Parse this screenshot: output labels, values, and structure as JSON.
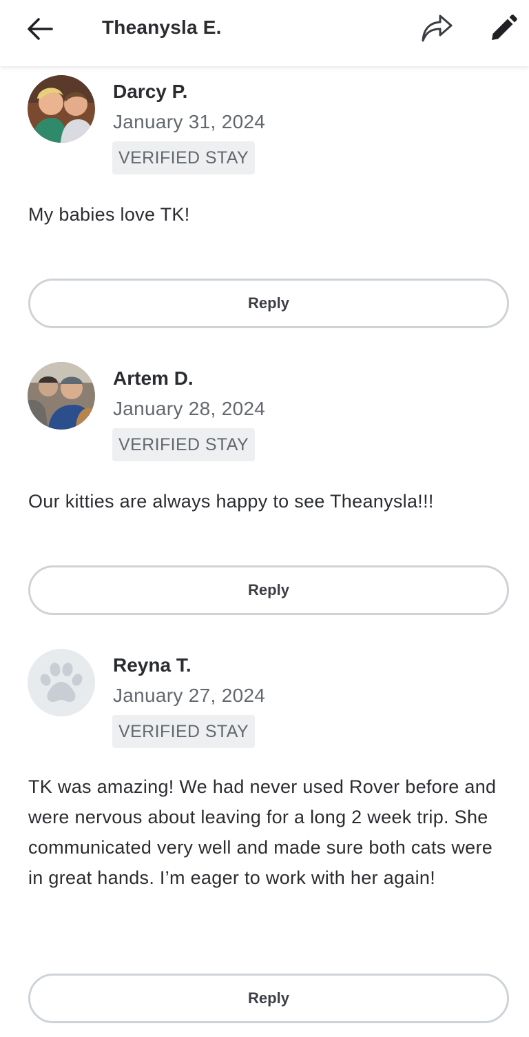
{
  "header": {
    "title": "Theanysla E.",
    "back_icon": "arrow-left-icon",
    "share_icon": "share-icon",
    "edit_icon": "pencil-icon"
  },
  "reviews": [
    {
      "name": "Darcy P.",
      "date": "January 31, 2024",
      "badge": "VERIFIED STAY",
      "text": "My babies love TK!",
      "reply_label": "Reply",
      "avatar": "photo-avatar"
    },
    {
      "name": "Artem D.",
      "date": "January 28, 2024",
      "badge": "VERIFIED STAY",
      "text": "Our kitties are always happy to see Theanysla!!!",
      "reply_label": "Reply",
      "avatar": "photo-avatar"
    },
    {
      "name": "Reyna T.",
      "date": "January 27, 2024",
      "badge": "VERIFIED STAY",
      "text": "TK was amazing! We had never used Rover before and were nervous about leaving for a long 2 week trip. She communicated very well and made sure both cats were in great hands. I’m eager to work with her again!",
      "reply_label": "Reply",
      "avatar": "paw-placeholder-icon"
    }
  ],
  "colors": {
    "text_primary": "#2a2c30",
    "text_secondary": "#62686e",
    "badge_bg": "#eeeff1",
    "button_border": "#ced3d8",
    "placeholder_avatar_bg": "#e8ebee",
    "placeholder_paw": "#c8ced4"
  }
}
